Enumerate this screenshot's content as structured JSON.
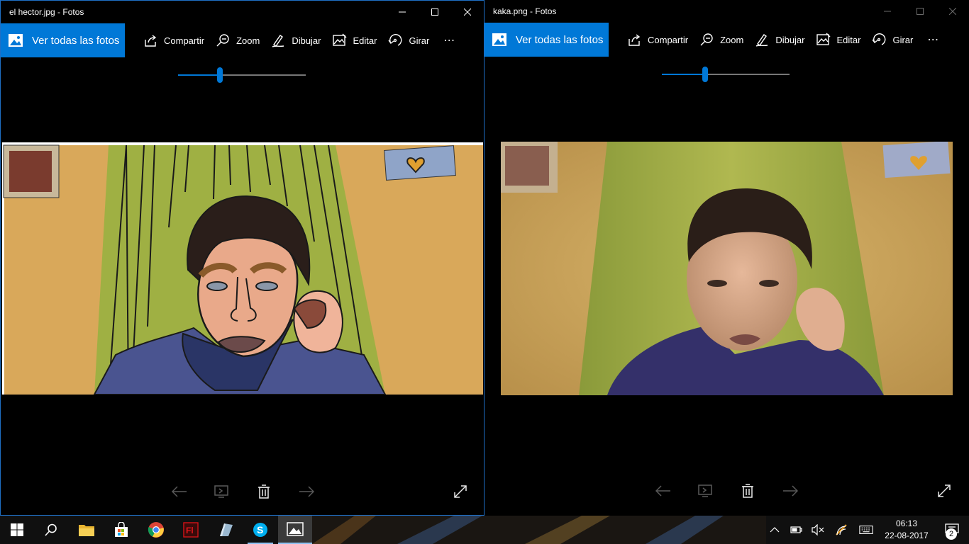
{
  "windows": [
    {
      "title": "el hector.jpg - Fotos",
      "toolbar": {
        "view_all_label": "Ver todas las fotos",
        "share_label": "Compartir",
        "zoom_label": "Zoom",
        "draw_label": "Dibujar",
        "edit_label": "Editar",
        "rotate_label": "Girar",
        "more_label": "⋯"
      },
      "zoom_level": 0.33,
      "photo": {
        "type": "cartoon-illustration",
        "subject": "drawn boy resting head on hand in front of green curtain"
      },
      "active": true
    },
    {
      "title": "kaka.png - Fotos",
      "toolbar": {
        "view_all_label": "Ver todas las fotos",
        "share_label": "Compartir",
        "zoom_label": "Zoom",
        "draw_label": "Dibujar",
        "edit_label": "Editar",
        "rotate_label": "Girar",
        "more_label": "⋯"
      },
      "zoom_level": 0.34,
      "photo": {
        "type": "webcam-photo",
        "subject": "boy resting head on hand in front of green curtain"
      },
      "active": false
    }
  ],
  "taskbar": {
    "pinned_icons": [
      "windows-start-icon",
      "search-icon",
      "file-explorer-icon",
      "store-icon",
      "chrome-icon",
      "flash-icon",
      "app-icon",
      "skype-icon",
      "photos-icon"
    ],
    "tray_icons": [
      "chevron-up-icon",
      "battery-icon",
      "volume-muted-icon",
      "wifi-icon",
      "keyboard-icon"
    ],
    "time": "06:13",
    "date": "22-08-2017",
    "notification_count": "2"
  },
  "colors": {
    "accent": "#0078d7",
    "window_bg": "#000000",
    "taskbar_bg": "#101010"
  }
}
